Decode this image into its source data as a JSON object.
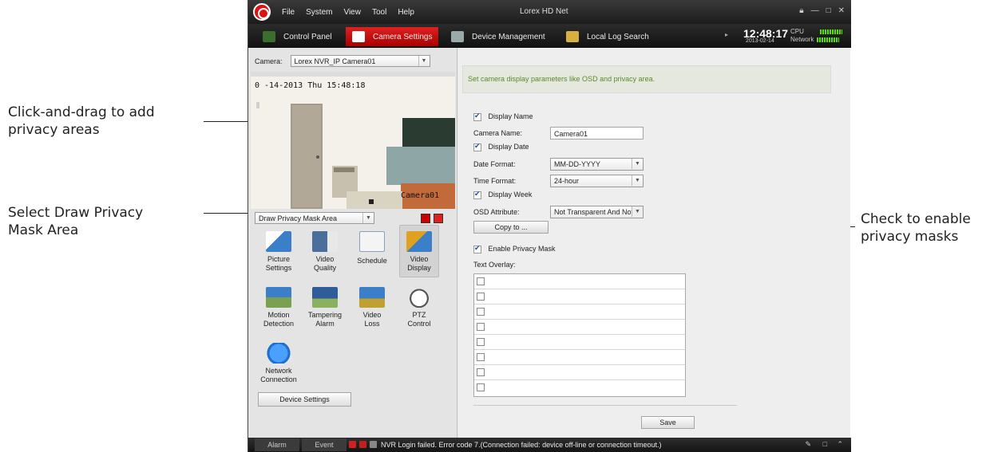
{
  "callouts": {
    "privacy_areas": [
      "Click-and-drag to add",
      "privacy areas"
    ],
    "draw_mask": [
      "Select Draw Privacy",
      "Mask Area"
    ],
    "enable_masks": [
      "Check to enable",
      "privacy masks"
    ]
  },
  "titlebar": {
    "menu": [
      "File",
      "System",
      "View",
      "Tool",
      "Help"
    ],
    "title": "Lorex HD Net"
  },
  "tabs": [
    {
      "label": "Control Panel",
      "icon": "control-panel-icon"
    },
    {
      "label": "Camera Settings",
      "icon": "camera-settings-icon"
    },
    {
      "label": "Device Management",
      "icon": "device-management-icon"
    },
    {
      "label": "Local Log Search",
      "icon": "log-search-icon"
    }
  ],
  "clock": {
    "time": "12:48:17",
    "date": "2013-02-14",
    "cpu_label": "CPU",
    "network_label": "Network"
  },
  "left": {
    "camera_label": "Camera:",
    "camera_value": "Lorex NVR_IP Camera01",
    "osd_datetime": "0 -14-2013 Thu 15:48:18",
    "osd_name": "Camera01",
    "mask_select": "Draw Privacy Mask Area",
    "tools": [
      {
        "label": [
          "Picture",
          "Settings"
        ],
        "icon": "picture-settings-icon",
        "color": "#3a7fc8"
      },
      {
        "label": [
          "Video",
          "Quality"
        ],
        "icon": "video-quality-icon",
        "color": "#4a6f9a"
      },
      {
        "label": [
          "Schedule"
        ],
        "icon": "schedule-icon",
        "color": "#8aa0c0"
      },
      {
        "label": [
          "Video",
          "Display"
        ],
        "icon": "video-display-icon",
        "color": "#e0a020"
      },
      {
        "label": [
          "Motion",
          "Detection"
        ],
        "icon": "motion-detection-icon",
        "color": "#3a7fc8"
      },
      {
        "label": [
          "Tampering",
          "Alarm"
        ],
        "icon": "tampering-alarm-icon",
        "color": "#2e5d9a"
      },
      {
        "label": [
          "Video",
          "Loss"
        ],
        "icon": "video-loss-icon",
        "color": "#3a7fc8"
      },
      {
        "label": [
          "PTZ",
          "Control"
        ],
        "icon": "ptz-control-icon",
        "color": "#cccccc"
      },
      {
        "label": [
          "Network",
          "Connection"
        ],
        "icon": "network-connection-icon",
        "color": "#1e6fd0"
      }
    ],
    "device_settings": "Device Settings"
  },
  "right": {
    "info": "Set camera display parameters like OSD and privacy area.",
    "display_name": "Display Name",
    "camera_name_label": "Camera Name:",
    "camera_name_value": "Camera01",
    "display_date": "Display Date",
    "date_format_label": "Date Format:",
    "date_format_value": "MM-DD-YYYY",
    "time_format_label": "Time Format:",
    "time_format_value": "24-hour",
    "display_week": "Display Week",
    "osd_attr_label": "OSD Attribute:",
    "osd_attr_value": "Not Transparent And Not",
    "copy_to": "Copy to ...",
    "enable_privacy": "Enable Privacy Mask",
    "text_overlay_label": "Text Overlay:",
    "overlay_rows": 8,
    "save": "Save"
  },
  "statusbar": {
    "alarm": "Alarm",
    "event": "Event",
    "message": "NVR Login failed. Error code 7.(Connection failed: device off-line or connection timeout.)"
  },
  "colors": {
    "accent_red": "#d01010",
    "info_green": "#5a8a2a"
  }
}
